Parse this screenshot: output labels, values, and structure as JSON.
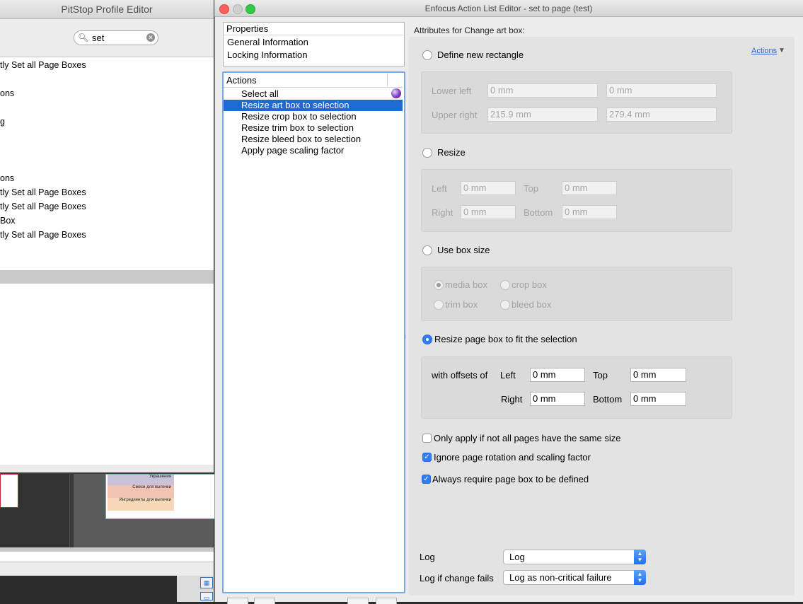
{
  "background_window": {
    "title": "PitStop Profile Editor",
    "search": {
      "value": "set"
    },
    "list_rows": [
      "tly Set all Page Boxes",
      "ons",
      "g",
      "ons",
      "tly Set all Page Boxes",
      "tly Set all Page Boxes",
      "Box",
      "tly Set all Page Boxes"
    ],
    "thumb_labels": [
      "Украшения",
      "Смеси для выпечки",
      "Ингредиенты для выпечки"
    ]
  },
  "window": {
    "title": "Enfocus Action List Editor - set to page (test)"
  },
  "properties": {
    "header": "Properties",
    "items": [
      "General Information",
      "Locking Information"
    ]
  },
  "actions": {
    "header": "Actions",
    "items": [
      {
        "label": "Select all",
        "selected": false
      },
      {
        "label": "Resize art box to selection",
        "selected": true
      },
      {
        "label": "Resize crop box to selection",
        "selected": false
      },
      {
        "label": "Resize trim box to selection",
        "selected": false
      },
      {
        "label": "Resize bleed box to selection",
        "selected": false
      },
      {
        "label": "Apply page scaling factor",
        "selected": false
      }
    ]
  },
  "attributes": {
    "title": "Attributes for Change art box:",
    "actions_menu": "Actions",
    "define_new_rectangle": {
      "label": "Define new rectangle",
      "lower_left_label": "Lower left",
      "upper_right_label": "Upper right",
      "lower_left_x": "0 mm",
      "lower_left_y": "0 mm",
      "upper_right_x": "215.9 mm",
      "upper_right_y": "279.4 mm"
    },
    "resize": {
      "label": "Resize",
      "left_label": "Left",
      "top_label": "Top",
      "right_label": "Right",
      "bottom_label": "Bottom",
      "left": "0 mm",
      "top": "0 mm",
      "right": "0 mm",
      "bottom": "0 mm"
    },
    "use_box_size": {
      "label": "Use box size",
      "options": [
        "media box",
        "crop box",
        "trim box",
        "bleed box"
      ],
      "selected": "media box"
    },
    "fit_selection": {
      "label": "Resize page box to fit the selection",
      "selected": true,
      "offsets_label": "with offsets of",
      "left_label": "Left",
      "top_label": "Top",
      "right_label": "Right",
      "bottom_label": "Bottom",
      "left": "0 mm",
      "top": "0 mm",
      "right": "0 mm",
      "bottom": "0 mm"
    },
    "checkboxes": [
      {
        "label": "Only apply if not all pages have the same size",
        "checked": false
      },
      {
        "label": "Ignore page rotation and scaling factor",
        "checked": true
      },
      {
        "label": "Always require page box to be defined",
        "checked": true
      }
    ],
    "log": {
      "label": "Log",
      "value": "Log"
    },
    "log_if_fails": {
      "label": "Log if change fails",
      "value": "Log as non-critical failure"
    }
  },
  "colors": {
    "selection": "#1f69d3",
    "accent": "#2f7ef5",
    "close": "#fc605c",
    "zoom": "#34c84a"
  }
}
